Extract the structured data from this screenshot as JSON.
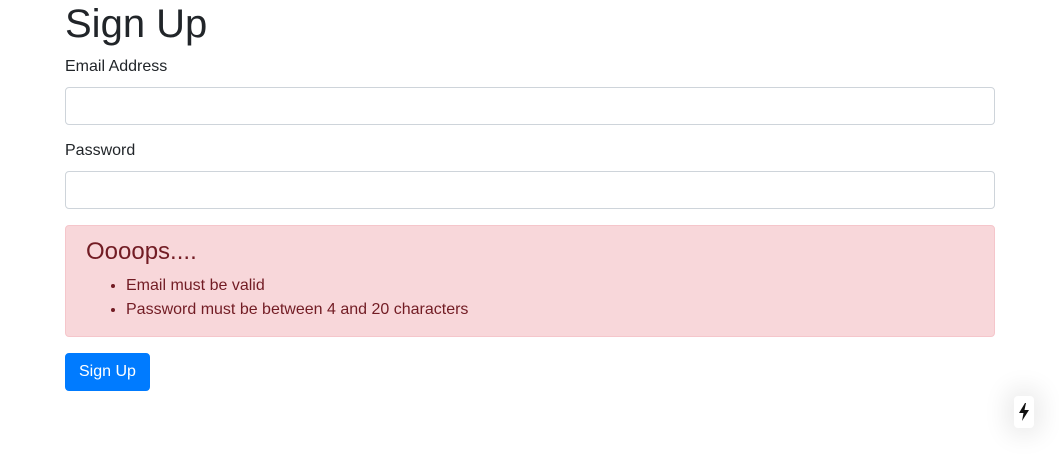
{
  "page": {
    "title": "Sign Up"
  },
  "form": {
    "email_label": "Email Address",
    "email_value": "",
    "password_label": "Password",
    "password_value": "",
    "submit_label": "Sign Up"
  },
  "alert": {
    "heading": "Oooops....",
    "errors": [
      "Email must be valid",
      "Password must be between 4 and 20 characters"
    ]
  },
  "colors": {
    "primary": "#007bff",
    "alert_bg": "#f8d7da",
    "alert_text": "#721c24"
  },
  "icons": {
    "dev_indicator": "lightning-bolt-icon"
  }
}
